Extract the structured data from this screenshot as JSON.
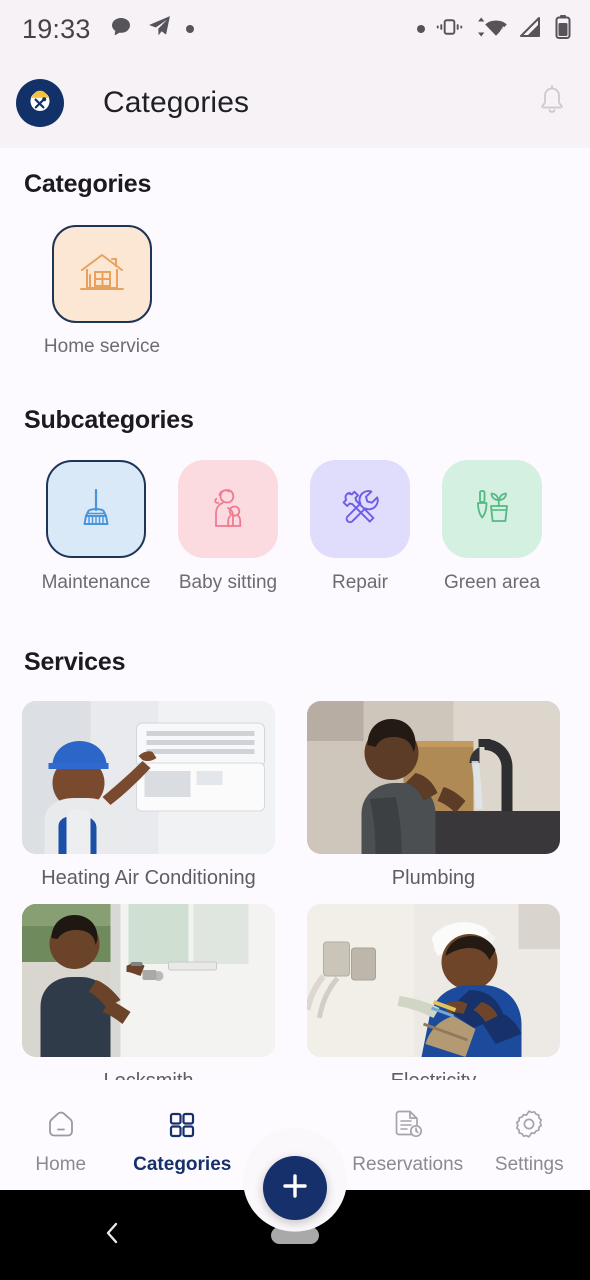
{
  "status_bar": {
    "time": "19:33",
    "left_icons": [
      "chat-bubble-icon",
      "telegram-send-icon",
      "dot-icon"
    ],
    "right_icons": [
      "dot-icon",
      "vibrate-icon",
      "wifi-icon",
      "signal-icon",
      "battery-icon"
    ],
    "wifi_badge": "4",
    "bg_color": "#f7f2f5"
  },
  "app_bar": {
    "title": "Categories",
    "logo_icon": "handyman-logo-icon",
    "notification_icon": "bell-icon",
    "brand_color": "#123169"
  },
  "categories_section": {
    "title": "Categories",
    "items": [
      {
        "label": "Home service",
        "icon": "house-icon",
        "bg": "#fce7d5",
        "fg": "#e8a15f",
        "selected": true
      }
    ]
  },
  "subcategories_section": {
    "title": "Subcategories",
    "items": [
      {
        "label": "Maintenance",
        "icon": "broom-icon",
        "bg": "#d9e9f8",
        "fg": "#4a94d8",
        "selected": true
      },
      {
        "label": "Baby sitting",
        "icon": "mother-baby-icon",
        "bg": "#fbdbdf",
        "fg": "#ef7b90",
        "selected": false
      },
      {
        "label": "Repair",
        "icon": "wrench-screwdriver-icon",
        "bg": "#e0dcfb",
        "fg": "#6c5ce7",
        "selected": false
      },
      {
        "label": "Green area",
        "icon": "plant-trowel-icon",
        "bg": "#d4f0e0",
        "fg": "#54b983",
        "selected": false
      }
    ]
  },
  "services_section": {
    "title": "Services",
    "items": [
      {
        "label": "Heating Air Conditioning",
        "photo": "technician-installing-ac-unit"
      },
      {
        "label": "Plumbing",
        "photo": "plumber-fixing-kitchen-faucet"
      },
      {
        "label": "Locksmith",
        "photo": "locksmith-working-on-door-lock"
      },
      {
        "label": "Electricity",
        "photo": "electrician-wiring-wall-socket"
      }
    ]
  },
  "fab": {
    "icon": "plus-icon",
    "color": "#16306b"
  },
  "bottom_nav": {
    "active_color": "#16306b",
    "inactive_color": "#8b8992",
    "items": [
      {
        "label": "Home",
        "icon": "home-icon",
        "active": false
      },
      {
        "label": "Categories",
        "icon": "grid-icon",
        "active": true
      },
      {
        "label": "Reservations",
        "icon": "document-clock-icon",
        "active": false
      },
      {
        "label": "Settings",
        "icon": "gear-icon",
        "active": false
      }
    ]
  },
  "android_nav": {
    "back_icon": "chevron-left-icon",
    "home_pill_icon": "home-pill-icon"
  }
}
